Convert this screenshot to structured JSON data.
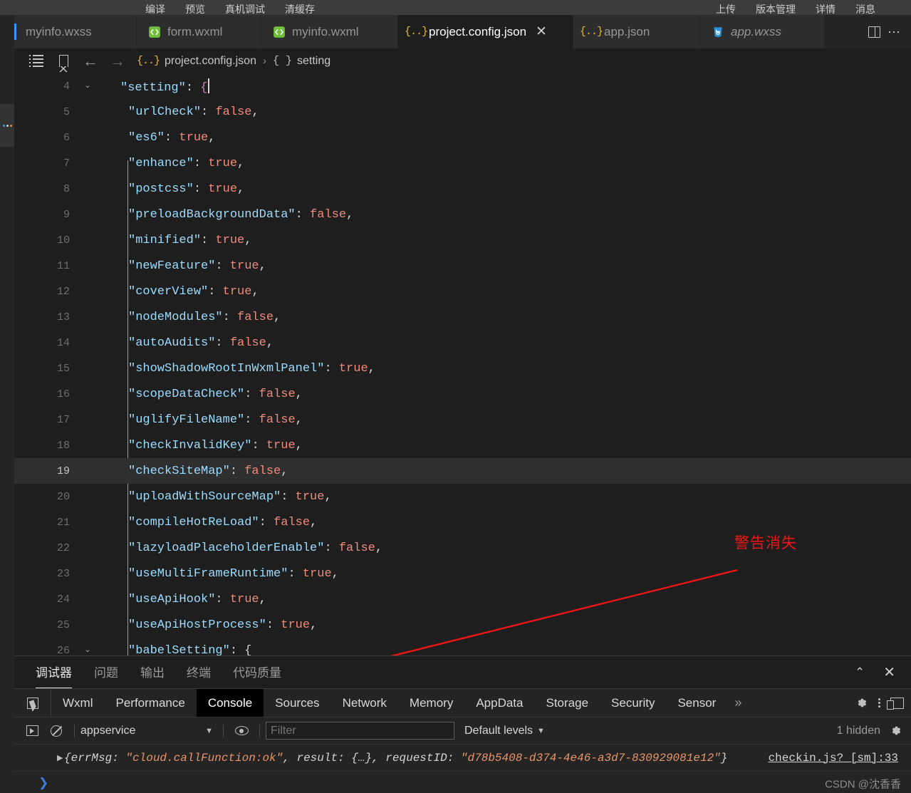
{
  "menubar": {
    "left_items": [
      "编译",
      "预览",
      "真机调试",
      "清缓存"
    ],
    "right_items": [
      "上传",
      "版本管理",
      "详情",
      "消息"
    ]
  },
  "tabs": [
    {
      "label": "myinfo.wxss",
      "icon": "wxss-file-icon",
      "active": false,
      "italic": false,
      "closable": false
    },
    {
      "label": "form.wxml",
      "icon": "wxml-file-icon",
      "active": false,
      "italic": false,
      "closable": false
    },
    {
      "label": "myinfo.wxml",
      "icon": "wxml-file-icon",
      "active": false,
      "italic": false,
      "closable": false
    },
    {
      "label": "project.config.json",
      "icon": "json-file-icon",
      "active": true,
      "italic": false,
      "closable": true,
      "close_label": "✕"
    },
    {
      "label": "app.json",
      "icon": "json-file-icon",
      "active": false,
      "italic": false,
      "closable": false
    },
    {
      "label": "app.wxss",
      "icon": "wxss-file-icon",
      "active": false,
      "italic": true,
      "closable": false
    }
  ],
  "breadcrumb": {
    "file": "project.config.json",
    "separator": "›",
    "symbol": "setting",
    "file_brace": "{..}",
    "symbol_brace": "{ }"
  },
  "editor": {
    "lines": [
      {
        "num": "4",
        "fold": "⌄",
        "indent": 1,
        "tokens": [
          {
            "t": "\"setting\"",
            "c": "k"
          },
          {
            "t": ": ",
            "c": "p"
          },
          {
            "t": "{",
            "c": "br"
          }
        ],
        "cursor": true,
        "highlight": false
      },
      {
        "num": "5",
        "fold": "",
        "indent": 2,
        "tokens": [
          {
            "t": "\"urlCheck\"",
            "c": "k"
          },
          {
            "t": ": ",
            "c": "p"
          },
          {
            "t": "false",
            "c": "v"
          },
          {
            "t": ",",
            "c": "p"
          }
        ],
        "cursor": false,
        "highlight": false
      },
      {
        "num": "6",
        "fold": "",
        "indent": 2,
        "tokens": [
          {
            "t": "\"es6\"",
            "c": "k"
          },
          {
            "t": ": ",
            "c": "p"
          },
          {
            "t": "true",
            "c": "v"
          },
          {
            "t": ",",
            "c": "p"
          }
        ],
        "cursor": false,
        "highlight": false
      },
      {
        "num": "7",
        "fold": "",
        "indent": 2,
        "tokens": [
          {
            "t": "\"enhance\"",
            "c": "k"
          },
          {
            "t": ": ",
            "c": "p"
          },
          {
            "t": "true",
            "c": "v"
          },
          {
            "t": ",",
            "c": "p"
          }
        ],
        "cursor": false,
        "highlight": false
      },
      {
        "num": "8",
        "fold": "",
        "indent": 2,
        "tokens": [
          {
            "t": "\"postcss\"",
            "c": "k"
          },
          {
            "t": ": ",
            "c": "p"
          },
          {
            "t": "true",
            "c": "v"
          },
          {
            "t": ",",
            "c": "p"
          }
        ],
        "cursor": false,
        "highlight": false
      },
      {
        "num": "9",
        "fold": "",
        "indent": 2,
        "tokens": [
          {
            "t": "\"preloadBackgroundData\"",
            "c": "k"
          },
          {
            "t": ": ",
            "c": "p"
          },
          {
            "t": "false",
            "c": "v"
          },
          {
            "t": ",",
            "c": "p"
          }
        ],
        "cursor": false,
        "highlight": false
      },
      {
        "num": "10",
        "fold": "",
        "indent": 2,
        "tokens": [
          {
            "t": "\"minified\"",
            "c": "k"
          },
          {
            "t": ": ",
            "c": "p"
          },
          {
            "t": "true",
            "c": "v"
          },
          {
            "t": ",",
            "c": "p"
          }
        ],
        "cursor": false,
        "highlight": false
      },
      {
        "num": "11",
        "fold": "",
        "indent": 2,
        "tokens": [
          {
            "t": "\"newFeature\"",
            "c": "k"
          },
          {
            "t": ": ",
            "c": "p"
          },
          {
            "t": "true",
            "c": "v"
          },
          {
            "t": ",",
            "c": "p"
          }
        ],
        "cursor": false,
        "highlight": false
      },
      {
        "num": "12",
        "fold": "",
        "indent": 2,
        "tokens": [
          {
            "t": "\"coverView\"",
            "c": "k"
          },
          {
            "t": ": ",
            "c": "p"
          },
          {
            "t": "true",
            "c": "v"
          },
          {
            "t": ",",
            "c": "p"
          }
        ],
        "cursor": false,
        "highlight": false
      },
      {
        "num": "13",
        "fold": "",
        "indent": 2,
        "tokens": [
          {
            "t": "\"nodeModules\"",
            "c": "k"
          },
          {
            "t": ": ",
            "c": "p"
          },
          {
            "t": "false",
            "c": "v"
          },
          {
            "t": ",",
            "c": "p"
          }
        ],
        "cursor": false,
        "highlight": false
      },
      {
        "num": "14",
        "fold": "",
        "indent": 2,
        "tokens": [
          {
            "t": "\"autoAudits\"",
            "c": "k"
          },
          {
            "t": ": ",
            "c": "p"
          },
          {
            "t": "false",
            "c": "v"
          },
          {
            "t": ",",
            "c": "p"
          }
        ],
        "cursor": false,
        "highlight": false
      },
      {
        "num": "15",
        "fold": "",
        "indent": 2,
        "tokens": [
          {
            "t": "\"showShadowRootInWxmlPanel\"",
            "c": "k"
          },
          {
            "t": ": ",
            "c": "p"
          },
          {
            "t": "true",
            "c": "v"
          },
          {
            "t": ",",
            "c": "p"
          }
        ],
        "cursor": false,
        "highlight": false
      },
      {
        "num": "16",
        "fold": "",
        "indent": 2,
        "tokens": [
          {
            "t": "\"scopeDataCheck\"",
            "c": "k"
          },
          {
            "t": ": ",
            "c": "p"
          },
          {
            "t": "false",
            "c": "v"
          },
          {
            "t": ",",
            "c": "p"
          }
        ],
        "cursor": false,
        "highlight": false
      },
      {
        "num": "17",
        "fold": "",
        "indent": 2,
        "tokens": [
          {
            "t": "\"uglifyFileName\"",
            "c": "k"
          },
          {
            "t": ": ",
            "c": "p"
          },
          {
            "t": "false",
            "c": "v"
          },
          {
            "t": ",",
            "c": "p"
          }
        ],
        "cursor": false,
        "highlight": false
      },
      {
        "num": "18",
        "fold": "",
        "indent": 2,
        "tokens": [
          {
            "t": "\"checkInvalidKey\"",
            "c": "k"
          },
          {
            "t": ": ",
            "c": "p"
          },
          {
            "t": "true",
            "c": "v"
          },
          {
            "t": ",",
            "c": "p"
          }
        ],
        "cursor": false,
        "highlight": false
      },
      {
        "num": "19",
        "fold": "",
        "indent": 2,
        "tokens": [
          {
            "t": "\"checkSiteMap\"",
            "c": "k"
          },
          {
            "t": ": ",
            "c": "p"
          },
          {
            "t": "false",
            "c": "v"
          },
          {
            "t": ",",
            "c": "p"
          }
        ],
        "cursor": false,
        "highlight": true
      },
      {
        "num": "20",
        "fold": "",
        "indent": 2,
        "tokens": [
          {
            "t": "\"uploadWithSourceMap\"",
            "c": "k"
          },
          {
            "t": ": ",
            "c": "p"
          },
          {
            "t": "true",
            "c": "v"
          },
          {
            "t": ",",
            "c": "p"
          }
        ],
        "cursor": false,
        "highlight": false
      },
      {
        "num": "21",
        "fold": "",
        "indent": 2,
        "tokens": [
          {
            "t": "\"compileHotReLoad\"",
            "c": "k"
          },
          {
            "t": ": ",
            "c": "p"
          },
          {
            "t": "false",
            "c": "v"
          },
          {
            "t": ",",
            "c": "p"
          }
        ],
        "cursor": false,
        "highlight": false
      },
      {
        "num": "22",
        "fold": "",
        "indent": 2,
        "tokens": [
          {
            "t": "\"lazyloadPlaceholderEnable\"",
            "c": "k"
          },
          {
            "t": ": ",
            "c": "p"
          },
          {
            "t": "false",
            "c": "v"
          },
          {
            "t": ",",
            "c": "p"
          }
        ],
        "cursor": false,
        "highlight": false
      },
      {
        "num": "23",
        "fold": "",
        "indent": 2,
        "tokens": [
          {
            "t": "\"useMultiFrameRuntime\"",
            "c": "k"
          },
          {
            "t": ": ",
            "c": "p"
          },
          {
            "t": "true",
            "c": "v"
          },
          {
            "t": ",",
            "c": "p"
          }
        ],
        "cursor": false,
        "highlight": false
      },
      {
        "num": "24",
        "fold": "",
        "indent": 2,
        "tokens": [
          {
            "t": "\"useApiHook\"",
            "c": "k"
          },
          {
            "t": ": ",
            "c": "p"
          },
          {
            "t": "true",
            "c": "v"
          },
          {
            "t": ",",
            "c": "p"
          }
        ],
        "cursor": false,
        "highlight": false
      },
      {
        "num": "25",
        "fold": "",
        "indent": 2,
        "tokens": [
          {
            "t": "\"useApiHostProcess\"",
            "c": "k"
          },
          {
            "t": ": ",
            "c": "p"
          },
          {
            "t": "true",
            "c": "v"
          },
          {
            "t": ",",
            "c": "p"
          }
        ],
        "cursor": false,
        "highlight": false
      },
      {
        "num": "26",
        "fold": "⌄",
        "indent": 2,
        "tokens": [
          {
            "t": "\"babelSetting\"",
            "c": "k"
          },
          {
            "t": ": ",
            "c": "p"
          },
          {
            "t": "{",
            "c": "p"
          }
        ],
        "cursor": false,
        "highlight": false
      }
    ]
  },
  "annotation": {
    "text": "警告消失",
    "color": "#f01414"
  },
  "panel": {
    "tabs": [
      "调试器",
      "问题",
      "输出",
      "终端",
      "代码质量"
    ],
    "active_tab": "调试器",
    "collapse_icon": "⌃",
    "close_icon": "✕"
  },
  "devtools": {
    "tabs": [
      "Wxml",
      "Performance",
      "Console",
      "Sources",
      "Network",
      "Memory",
      "AppData",
      "Storage",
      "Security",
      "Sensor"
    ],
    "active_tab": "Console",
    "overflow_label": "»"
  },
  "console": {
    "context": "appservice",
    "filter_placeholder": "Filter",
    "filter_value": "",
    "levels_label": "Default levels",
    "levels_caret": "▼",
    "hidden_label": "1 hidden",
    "log": {
      "expand_icon": "▶",
      "prefix": "{errMsg: ",
      "errmsg": "\"cloud.callFunction:ok\"",
      "mid": ", result: {…}, requestID: ",
      "request_id": "\"d78b5408-d374-4e46-a3d7-830929081e12\"",
      "suffix": "}",
      "source": "checkin.js? [sm]:33"
    },
    "prompt_symbol": "❯"
  },
  "watermark": "CSDN @沈香香"
}
